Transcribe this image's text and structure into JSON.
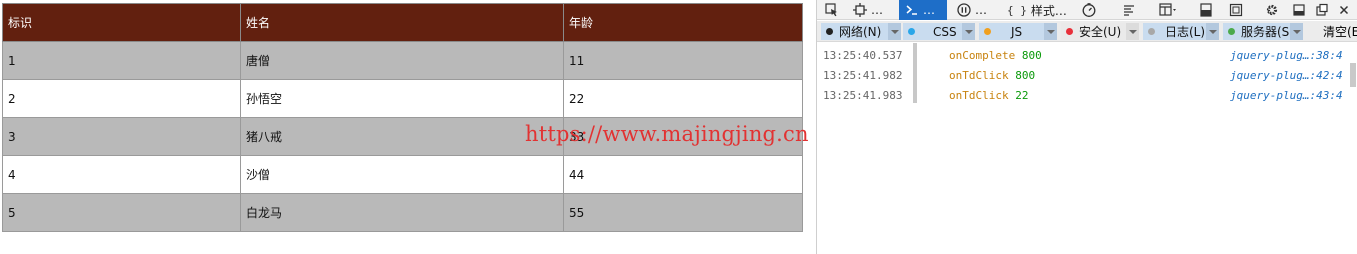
{
  "table": {
    "headers": [
      "标识",
      "姓名",
      "年龄"
    ],
    "rows": [
      [
        "1",
        "唐僧",
        "11"
      ],
      [
        "2",
        "孙悟空",
        "22"
      ],
      [
        "3",
        "猪八戒",
        "33"
      ],
      [
        "4",
        "沙僧",
        "44"
      ],
      [
        "5",
        "白龙马",
        "55"
      ]
    ],
    "colors": {
      "header_bg": "#62200f",
      "odd_row_bg": "#b9b9b9",
      "even_row_bg": "#ffffff"
    }
  },
  "watermark": {
    "text": "https://www.majingjing.cn",
    "color": "#e23232"
  },
  "devtools": {
    "tabs": [
      {
        "icon": "cursor-select-icon",
        "label": ""
      },
      {
        "icon": "inspector-icon",
        "label": "…"
      },
      {
        "icon": "console-icon",
        "label": "…",
        "active": true
      },
      {
        "icon": "debugger-icon",
        "label": "…"
      },
      {
        "icon": "style-editor-icon",
        "label": "样式…"
      },
      {
        "icon": "performance-icon",
        "label": ""
      },
      {
        "icon": "options-icon",
        "label": ""
      },
      {
        "icon": "frames-icon",
        "label": ""
      },
      {
        "icon": "responsive-icon",
        "label": ""
      },
      {
        "icon": "screenshot-icon",
        "label": ""
      },
      {
        "icon": "gear-icon",
        "label": ""
      },
      {
        "icon": "dock-icon",
        "label": ""
      },
      {
        "icon": "undock-icon",
        "label": ""
      },
      {
        "icon": "close-icon",
        "label": ""
      }
    ],
    "filters": [
      {
        "label": "网络(N)",
        "dot": "#222222",
        "on": true
      },
      {
        "label": "CSS",
        "dot": "#2aa6e8",
        "on": true
      },
      {
        "label": "JS",
        "dot": "#f0a020",
        "on": true
      },
      {
        "label": "安全(U)",
        "dot": "#e8303a",
        "on": false
      },
      {
        "label": "日志(L)",
        "dot": "#a8a8a8",
        "on": true
      },
      {
        "label": "服务器(S)",
        "dot": "#4caa4c",
        "on": true
      }
    ],
    "clear_label": "清空(E",
    "logs": [
      {
        "time": "13:25:40.537",
        "message": "onComplete",
        "value": "800",
        "source": "jquery-plug…:38:4"
      },
      {
        "time": "13:25:41.982",
        "message": "onTdClick",
        "value": "800",
        "source": "jquery-plug…:42:4"
      },
      {
        "time": "13:25:41.983",
        "message": "onTdClick",
        "value": "22",
        "source": "jquery-plug…:43:4"
      }
    ],
    "accent": "#1e6ec8"
  }
}
